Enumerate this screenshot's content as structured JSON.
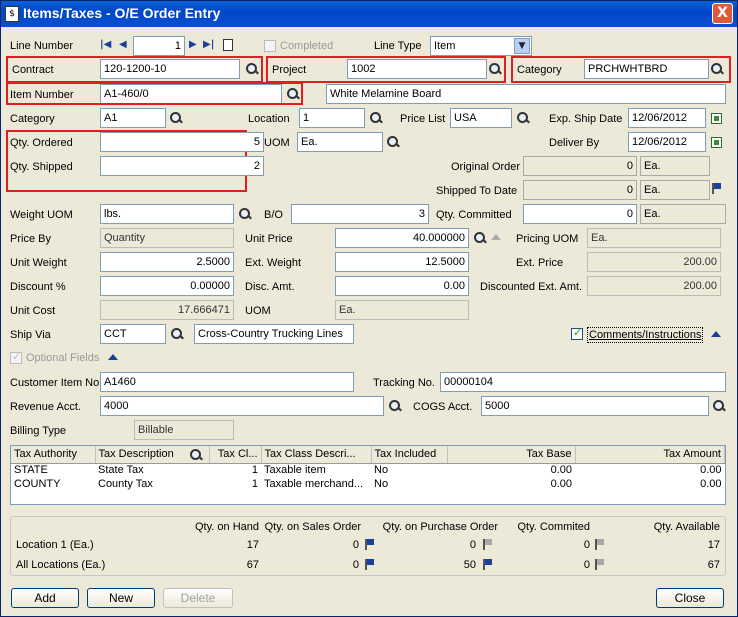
{
  "window": {
    "title": "Items/Taxes - O/E Order Entry",
    "close_glyph": "X"
  },
  "line": {
    "label": "Line Number",
    "value": "1",
    "completed_label": "Completed",
    "line_type_label": "Line Type",
    "line_type_value": "Item"
  },
  "contract": {
    "label": "Contract",
    "value": "120-1200-10"
  },
  "project": {
    "label": "Project",
    "value": "1002"
  },
  "category_top": {
    "label": "Category",
    "value": "PRCHWHTBRD"
  },
  "item_number": {
    "label": "Item Number",
    "value": "A1-460/0",
    "description": "White Melamine Board"
  },
  "category": {
    "label": "Category",
    "value": "A1"
  },
  "location": {
    "label": "Location",
    "value": "1"
  },
  "price_list": {
    "label": "Price List",
    "value": "USA"
  },
  "exp_ship_date": {
    "label": "Exp. Ship Date",
    "value": "12/06/2012"
  },
  "deliver_by": {
    "label": "Deliver By",
    "value": "12/06/2012"
  },
  "qty_ordered": {
    "label": "Qty. Ordered",
    "value": "5"
  },
  "qty_shipped": {
    "label": "Qty. Shipped",
    "value": "2"
  },
  "uom": {
    "label": "UOM",
    "value": "Ea."
  },
  "original_order": {
    "label": "Original Order",
    "value": "0",
    "uom": "Ea."
  },
  "shipped_to_date": {
    "label": "Shipped To Date",
    "value": "0",
    "uom": "Ea."
  },
  "weight_uom": {
    "label": "Weight UOM",
    "value": "lbs."
  },
  "bo": {
    "label": "B/O",
    "value": "3"
  },
  "qty_committed": {
    "label": "Qty. Committed",
    "value": "0",
    "uom": "Ea."
  },
  "price_by": {
    "label": "Price By",
    "value": "Quantity"
  },
  "unit_price": {
    "label": "Unit Price",
    "value": "40.000000"
  },
  "pricing_uom": {
    "label": "Pricing UOM",
    "value": "Ea."
  },
  "unit_weight": {
    "label": "Unit Weight",
    "value": "2.5000"
  },
  "ext_weight": {
    "label": "Ext. Weight",
    "value": "12.5000"
  },
  "ext_price": {
    "label": "Ext. Price",
    "value": "200.00"
  },
  "discount_pct": {
    "label": "Discount %",
    "value": "0.00000"
  },
  "disc_amt": {
    "label": "Disc. Amt.",
    "value": "0.00"
  },
  "discounted_ext_amt": {
    "label": "Discounted Ext. Amt.",
    "value": "200.00"
  },
  "unit_cost": {
    "label": "Unit Cost",
    "value": "17.666471"
  },
  "uom2": {
    "label": "UOM",
    "value": "Ea."
  },
  "ship_via": {
    "label": "Ship Via",
    "value": "CCT",
    "description": "Cross-Country Trucking Lines"
  },
  "comments_label": "Comments/Instructions",
  "optional_fields_label": "Optional Fields",
  "customer_item_no": {
    "label": "Customer Item No.",
    "value": "A1460"
  },
  "tracking_no": {
    "label": "Tracking No.",
    "value": "00000104"
  },
  "revenue_acct": {
    "label": "Revenue Acct.",
    "value": "4000"
  },
  "cogs_acct": {
    "label": "COGS Acct.",
    "value": "5000"
  },
  "billing_type": {
    "label": "Billing Type",
    "value": "Billable"
  },
  "tax_grid": {
    "headers": [
      "Tax Authority",
      "Tax Description",
      "Tax Cl...",
      "Tax Class Descri...",
      "Tax Included",
      "Tax Base",
      "Tax Amount"
    ],
    "rows": [
      [
        "STATE",
        "State Tax",
        "1",
        "Taxable item",
        "No",
        "0.00",
        "0.00"
      ],
      [
        "COUNTY",
        "County Tax",
        "1",
        "Taxable merchand...",
        "No",
        "0.00",
        "0.00"
      ]
    ]
  },
  "stock": {
    "headers": [
      "Qty. on Hand",
      "Qty. on Sales Order",
      "Qty. on Purchase Order",
      "Qty. Commited",
      "Qty. Available"
    ],
    "rows": [
      {
        "label": "Location  1 (Ea.)",
        "on_hand": "17",
        "on_so": "0",
        "on_po": "0",
        "committed": "0",
        "available": "17"
      },
      {
        "label": "All Locations (Ea.)",
        "on_hand": "67",
        "on_so": "0",
        "on_po": "50",
        "committed": "0",
        "available": "67"
      }
    ]
  },
  "buttons": {
    "add": "Add",
    "new": "New",
    "delete": "Delete",
    "close": "Close"
  },
  "colors": {
    "highlight_box": "#e02020",
    "window_bg": "#ece9d8",
    "title_bar": "#0a5fd8"
  }
}
